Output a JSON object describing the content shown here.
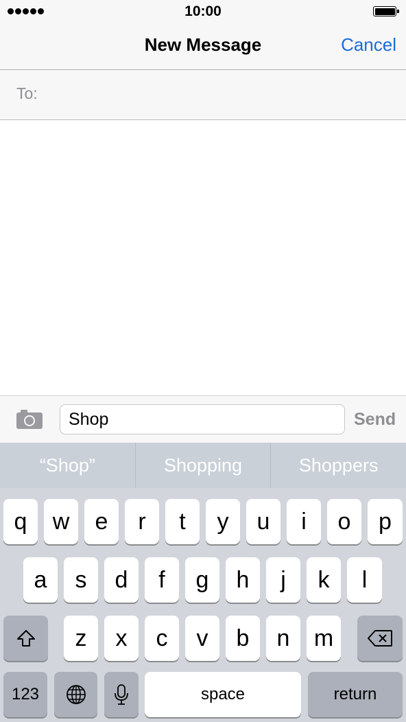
{
  "status_bar": {
    "time": "10:00"
  },
  "nav": {
    "title": "New Message",
    "cancel_label": "Cancel"
  },
  "recipient": {
    "label": "To:",
    "value": ""
  },
  "compose": {
    "text": "Shop",
    "send_label": "Send"
  },
  "predictions": [
    "“Shop”",
    "Shopping",
    "Shoppers"
  ],
  "keyboard": {
    "row1": [
      "q",
      "w",
      "e",
      "r",
      "t",
      "y",
      "u",
      "i",
      "o",
      "p"
    ],
    "row2": [
      "a",
      "s",
      "d",
      "f",
      "g",
      "h",
      "j",
      "k",
      "l"
    ],
    "row3": [
      "z",
      "x",
      "c",
      "v",
      "b",
      "n",
      "m"
    ],
    "numbers_label": "123",
    "space_label": "space",
    "return_label": "return",
    "icons": {
      "shift": "shift-icon",
      "delete": "delete-icon",
      "globe": "globe-icon",
      "mic": "mic-icon",
      "camera": "camera-icon"
    }
  },
  "colors": {
    "accent": "#1a6cd7",
    "keyboard_bg": "#d2d5db",
    "prediction_bar": "#c9d0d8",
    "disabled_text": "#8e8e93"
  }
}
